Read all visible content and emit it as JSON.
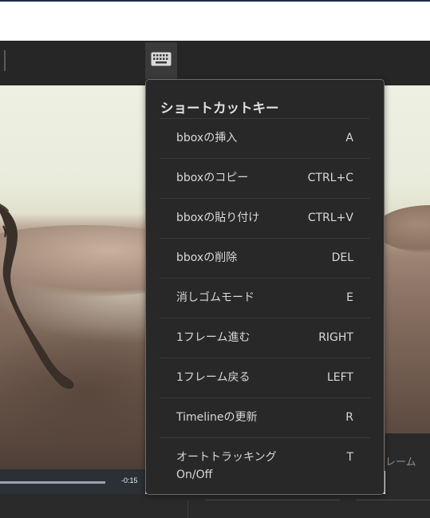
{
  "toolbar": {
    "keyboard_icon": "keyboard-icon"
  },
  "shortcut_panel": {
    "title": "ショートカットキー",
    "items": [
      {
        "label": "bboxの挿入",
        "key": "A"
      },
      {
        "label": "bboxのコピー",
        "key": "CTRL+C"
      },
      {
        "label": "bboxの貼り付け",
        "key": "CTRL+V"
      },
      {
        "label": "bboxの削除",
        "key": "DEL"
      },
      {
        "label": "消しゴムモード",
        "key": "E"
      },
      {
        "label": "1フレーム進む",
        "key": "RIGHT"
      },
      {
        "label": "1フレーム戻る",
        "key": "LEFT"
      },
      {
        "label": "Timelineの更新",
        "key": "R"
      },
      {
        "label": "オートトラッキング\nOn/Off",
        "key": "T"
      }
    ]
  },
  "player": {
    "time_remaining": "-0:15"
  },
  "right_panel": {
    "partial_label": "レーム"
  },
  "colors": {
    "panel_bg": "#282828",
    "toolbar_bg": "#262626",
    "accent_line": "#1d2c46"
  }
}
